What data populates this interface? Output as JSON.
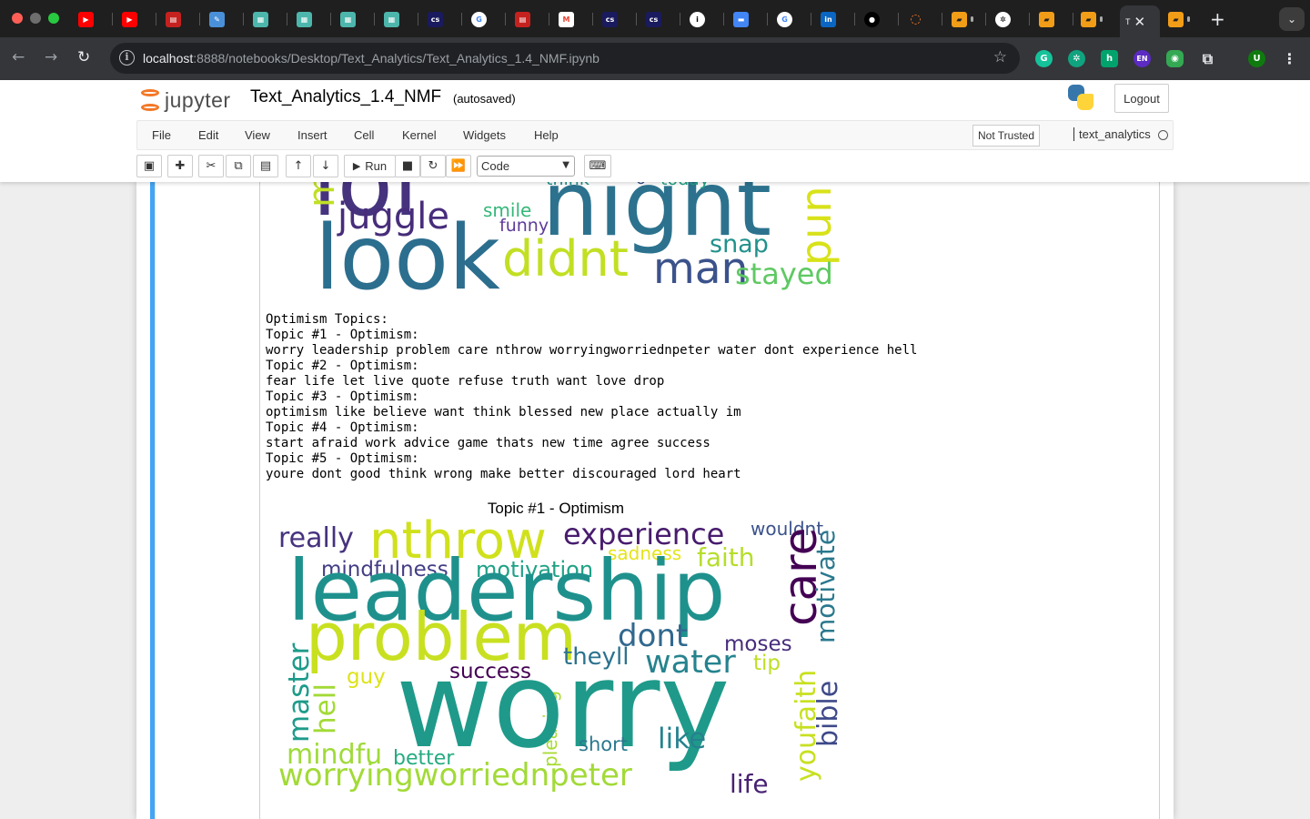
{
  "browser": {
    "active_tab_title": "T",
    "url_host": "localhost",
    "url_rest": ":8888/notebooks/Desktop/Text_Analytics/Text_Analytics_1.4_NMF.ipynb",
    "profile_initial": "U",
    "extension_labels": [
      "h",
      "EN"
    ]
  },
  "jupyter": {
    "brand": "jupyter",
    "notebook_name": "Text_Analytics_1.4_NMF",
    "autosave_status": "(autosaved)",
    "logout_label": "Logout",
    "menus": [
      "File",
      "Edit",
      "View",
      "Insert",
      "Cell",
      "Kernel",
      "Widgets",
      "Help"
    ],
    "trust_status": "Not Trusted",
    "kernel_name": "text_analytics",
    "run_label": "Run",
    "cell_type": "Code"
  },
  "output": {
    "text_lines": [
      "Optimism Topics:",
      "Topic #1 - Optimism:",
      "worry leadership problem care nthrow worryingworriednpeter water dont experience hell",
      "Topic #2 - Optimism:",
      "fear life let live quote refuse truth want love drop",
      "Topic #3 - Optimism:",
      "optimism like believe want think blessed new place actually im",
      "Topic #4 - Optimism:",
      "start afraid work advice game thats new time agree success",
      "Topic #5 - Optimism:",
      "youre dont good think wrong make better discouraged lord heart"
    ],
    "wordcloud_top_words": [
      {
        "text": "lol",
        "color": "#46337e"
      },
      {
        "text": "night",
        "color": "#2c728e"
      },
      {
        "text": "think",
        "color": "#21918c"
      },
      {
        "text": "o",
        "color": "#3b528b"
      },
      {
        "text": "today",
        "color": "#20a386"
      },
      {
        "text": "m",
        "color": "#c0df25"
      },
      {
        "text": "juggle",
        "color": "#472d7b"
      },
      {
        "text": "smile",
        "color": "#35b779"
      },
      {
        "text": "funny",
        "color": "#5e3c99"
      },
      {
        "text": "pun",
        "color": "#d8e219"
      },
      {
        "text": "look",
        "color": "#2c6e8e"
      },
      {
        "text": "didnt",
        "color": "#c2df23"
      },
      {
        "text": "snap",
        "color": "#21918c"
      },
      {
        "text": "man",
        "color": "#3b528b"
      },
      {
        "text": "stayed",
        "color": "#5ec962"
      }
    ],
    "wordcloud_title": "Topic #1 - Optimism",
    "wordcloud_bottom_words": [
      {
        "text": "really",
        "color": "#46327e"
      },
      {
        "text": "nthrow",
        "color": "#d0e11c"
      },
      {
        "text": "experience",
        "color": "#481c6e"
      },
      {
        "text": "wouldnt",
        "color": "#3b528b"
      },
      {
        "text": "sadness",
        "color": "#e5e419"
      },
      {
        "text": "faith",
        "color": "#b5de2b"
      },
      {
        "text": "mindfulness",
        "color": "#433e85"
      },
      {
        "text": "motivation",
        "color": "#1fa187"
      },
      {
        "text": "leadership",
        "color": "#1f918d"
      },
      {
        "text": "care",
        "color": "#440154"
      },
      {
        "text": "motivate",
        "color": "#2a788e"
      },
      {
        "text": "problem",
        "color": "#c8e020"
      },
      {
        "text": "dont",
        "color": "#31688e"
      },
      {
        "text": "moses",
        "color": "#472d7b"
      },
      {
        "text": "theyll",
        "color": "#2c728e"
      },
      {
        "text": "water",
        "color": "#25838e"
      },
      {
        "text": "tip",
        "color": "#bddf26"
      },
      {
        "text": "success",
        "color": "#440154"
      },
      {
        "text": "master",
        "color": "#1e9b8a"
      },
      {
        "text": "hell",
        "color": "#a2da37"
      },
      {
        "text": "guy",
        "color": "#dde318"
      },
      {
        "text": "youfaith",
        "color": "#c8e020"
      },
      {
        "text": "bible",
        "color": "#3e4989"
      },
      {
        "text": "pleasing",
        "color": "#a8db34"
      },
      {
        "text": "worry",
        "color": "#1f9a8a"
      },
      {
        "text": "short",
        "color": "#2a788e"
      },
      {
        "text": "like",
        "color": "#26828e"
      },
      {
        "text": "mindfu",
        "color": "#9fda3a"
      },
      {
        "text": "better",
        "color": "#25ab82"
      },
      {
        "text": "worryingworriednpeter",
        "color": "#a2da37"
      },
      {
        "text": "life",
        "color": "#482173"
      }
    ]
  }
}
